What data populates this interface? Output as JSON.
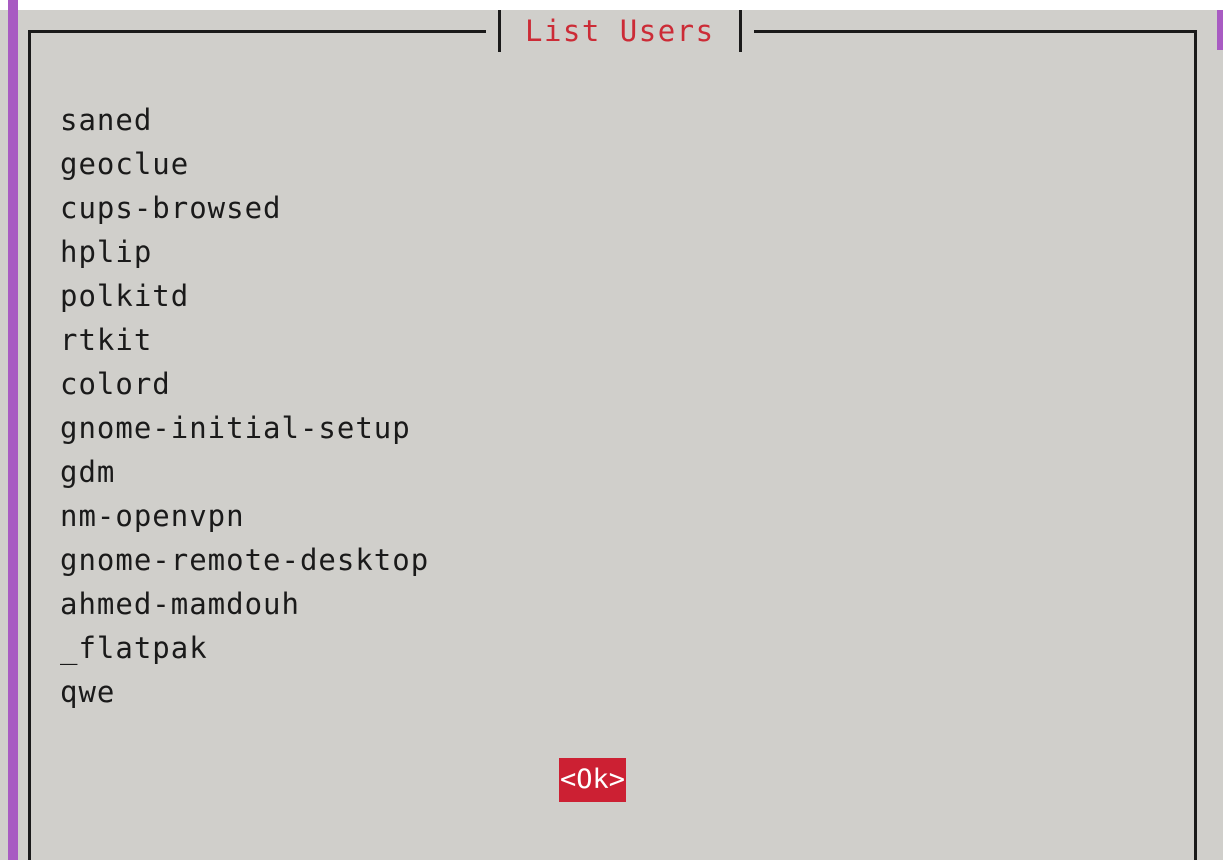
{
  "dialog": {
    "title": "List Users",
    "users": [
      "saned",
      "geoclue",
      "cups-browsed",
      "hplip",
      "polkitd",
      "rtkit",
      "colord",
      "gnome-initial-setup",
      "gdm",
      "nm-openvpn",
      "gnome-remote-desktop",
      "ahmed-mamdouh",
      "_flatpak",
      "qwe"
    ],
    "ok_label": "<Ok>"
  },
  "colors": {
    "background": "#d0cfcb",
    "title_text": "#cc2b36",
    "button_bg": "#cc2033",
    "button_text": "#ffffff",
    "window_accent": "#a85bc2",
    "frame_line": "#1a1a1a"
  }
}
